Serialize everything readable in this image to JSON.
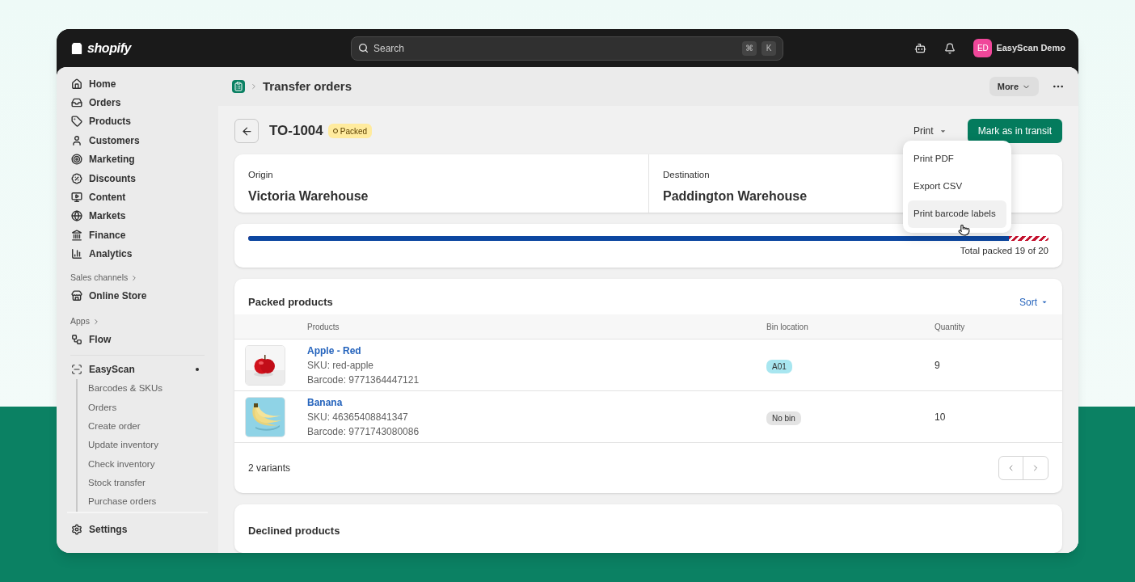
{
  "topbar": {
    "logo": "shopify",
    "search": {
      "placeholder": "Search",
      "keys": [
        "⌘",
        "K"
      ]
    },
    "account": {
      "initials": "ED",
      "name": "EasyScan Demo"
    }
  },
  "sidebar": {
    "items": [
      {
        "label": "Home"
      },
      {
        "label": "Orders"
      },
      {
        "label": "Products"
      },
      {
        "label": "Customers"
      },
      {
        "label": "Marketing"
      },
      {
        "label": "Discounts"
      },
      {
        "label": "Content"
      },
      {
        "label": "Markets"
      },
      {
        "label": "Finance"
      },
      {
        "label": "Analytics"
      }
    ],
    "sales_channels": {
      "heading": "Sales channels",
      "items": [
        {
          "label": "Online Store"
        }
      ]
    },
    "apps": {
      "heading": "Apps",
      "items": [
        {
          "label": "Flow"
        }
      ]
    },
    "app": {
      "label": "EasyScan",
      "children": [
        "Barcodes & SKUs",
        "Orders",
        "Create order",
        "Update inventory",
        "Check inventory",
        "Stock transfer",
        "Purchase orders"
      ]
    },
    "settings": "Settings"
  },
  "page_header": {
    "breadcrumb": "Transfer orders",
    "more": "More"
  },
  "order": {
    "title": "TO-1004",
    "status": "Packed",
    "print": "Print",
    "primary": "Mark as in transit"
  },
  "print_menu": {
    "items": [
      {
        "label": "Print PDF",
        "selected": false
      },
      {
        "label": "Export CSV",
        "selected": false
      },
      {
        "label": "Print barcode labels",
        "selected": true
      }
    ]
  },
  "locations": [
    {
      "label": "Origin",
      "value": "Victoria Warehouse"
    },
    {
      "label": "Destination",
      "value": "Paddington Warehouse"
    }
  ],
  "progress": {
    "level": 0.95,
    "reading": "Total packed 19 of 20"
  },
  "packed_products": {
    "title": "Packed products",
    "sort": "Sort",
    "columns": [
      "Products",
      "Bin location",
      "Quantity"
    ],
    "rows": [
      {
        "name": "Apple - Red",
        "sku": "SKU: red-apple",
        "barcode": "Barcode: 9771364447121",
        "bin": {
          "label": "A01",
          "color": "#a8e6f0"
        },
        "quantity": "9"
      },
      {
        "name": "Banana",
        "sku": "SKU: 46365408841347",
        "barcode": "Barcode: 9771743080086",
        "bin": {
          "label": "No bin",
          "color": "#e3e3e3"
        },
        "quantity": "10"
      }
    ],
    "footer": "2 variants"
  },
  "declined_products": {
    "title": "Declined products"
  }
}
